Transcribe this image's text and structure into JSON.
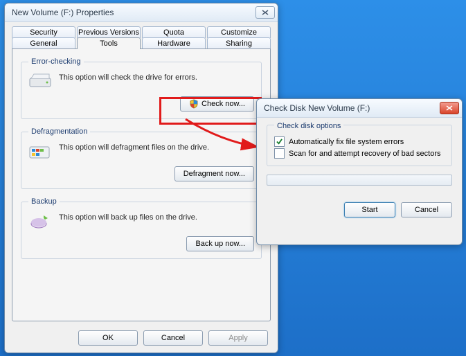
{
  "props": {
    "title": "New Volume (F:) Properties",
    "tabs_row1": [
      "Security",
      "Previous Versions",
      "Quota",
      "Customize"
    ],
    "tabs_row2": [
      "General",
      "Tools",
      "Hardware",
      "Sharing"
    ],
    "active_tab": "Tools",
    "error_checking": {
      "legend": "Error-checking",
      "desc": "This option will check the drive for errors.",
      "button": "Check now..."
    },
    "defrag": {
      "legend": "Defragmentation",
      "desc": "This option will defragment files on the drive.",
      "button": "Defragment now..."
    },
    "backup": {
      "legend": "Backup",
      "desc": "This option will back up files on the drive.",
      "button": "Back up now..."
    },
    "buttons": {
      "ok": "OK",
      "cancel": "Cancel",
      "apply": "Apply"
    }
  },
  "dlg": {
    "title": "Check Disk New Volume (F:)",
    "group": "Check disk options",
    "opt1": {
      "label": "Automatically fix file system errors",
      "checked": true
    },
    "opt2": {
      "label": "Scan for and attempt recovery of bad sectors",
      "checked": false
    },
    "start": "Start",
    "cancel": "Cancel"
  }
}
